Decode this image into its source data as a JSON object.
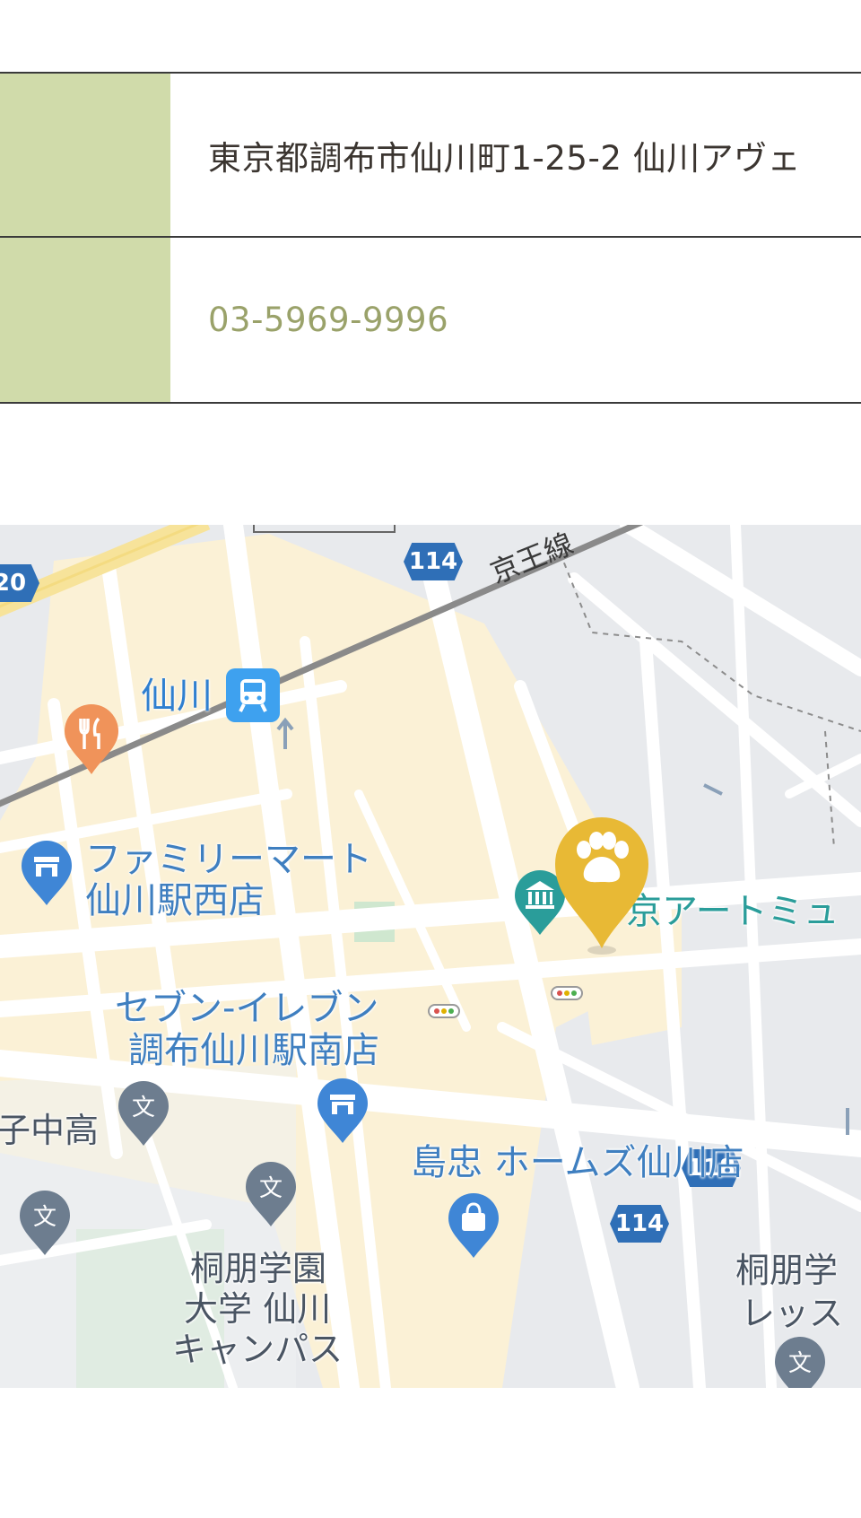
{
  "info": {
    "address": "東京都調布市仙川町1-25-2 仙川アヴェ",
    "phone": "03-5969-9996"
  },
  "map": {
    "labels": {
      "station": "仙川",
      "line": "京王線",
      "familymart_1": "ファミリーマート",
      "familymart_2": "仙川駅西店",
      "museum": "京アートミュ",
      "seven_1": "セブン-イレブン",
      "seven_2": "調布仙川駅南店",
      "shimachu": "島忠 ホームズ仙川店",
      "school_left": "子中高",
      "toho_1": "桐朋学園",
      "toho_2": "大学 仙川",
      "toho_3": "キャンパス",
      "toho_right_1": "桐朋学",
      "toho_right_2": "レッス"
    },
    "shields": {
      "r114_top": "114",
      "r20": "20",
      "r118": "118",
      "r114_bottom": "114"
    },
    "colors": {
      "pin_gold": "#e8b935",
      "station_blue": "#3ea1ef",
      "restaurant_orange": "#f0935a",
      "poi_blue": "#3f86d6",
      "school_gray": "#6d7d8f"
    }
  }
}
